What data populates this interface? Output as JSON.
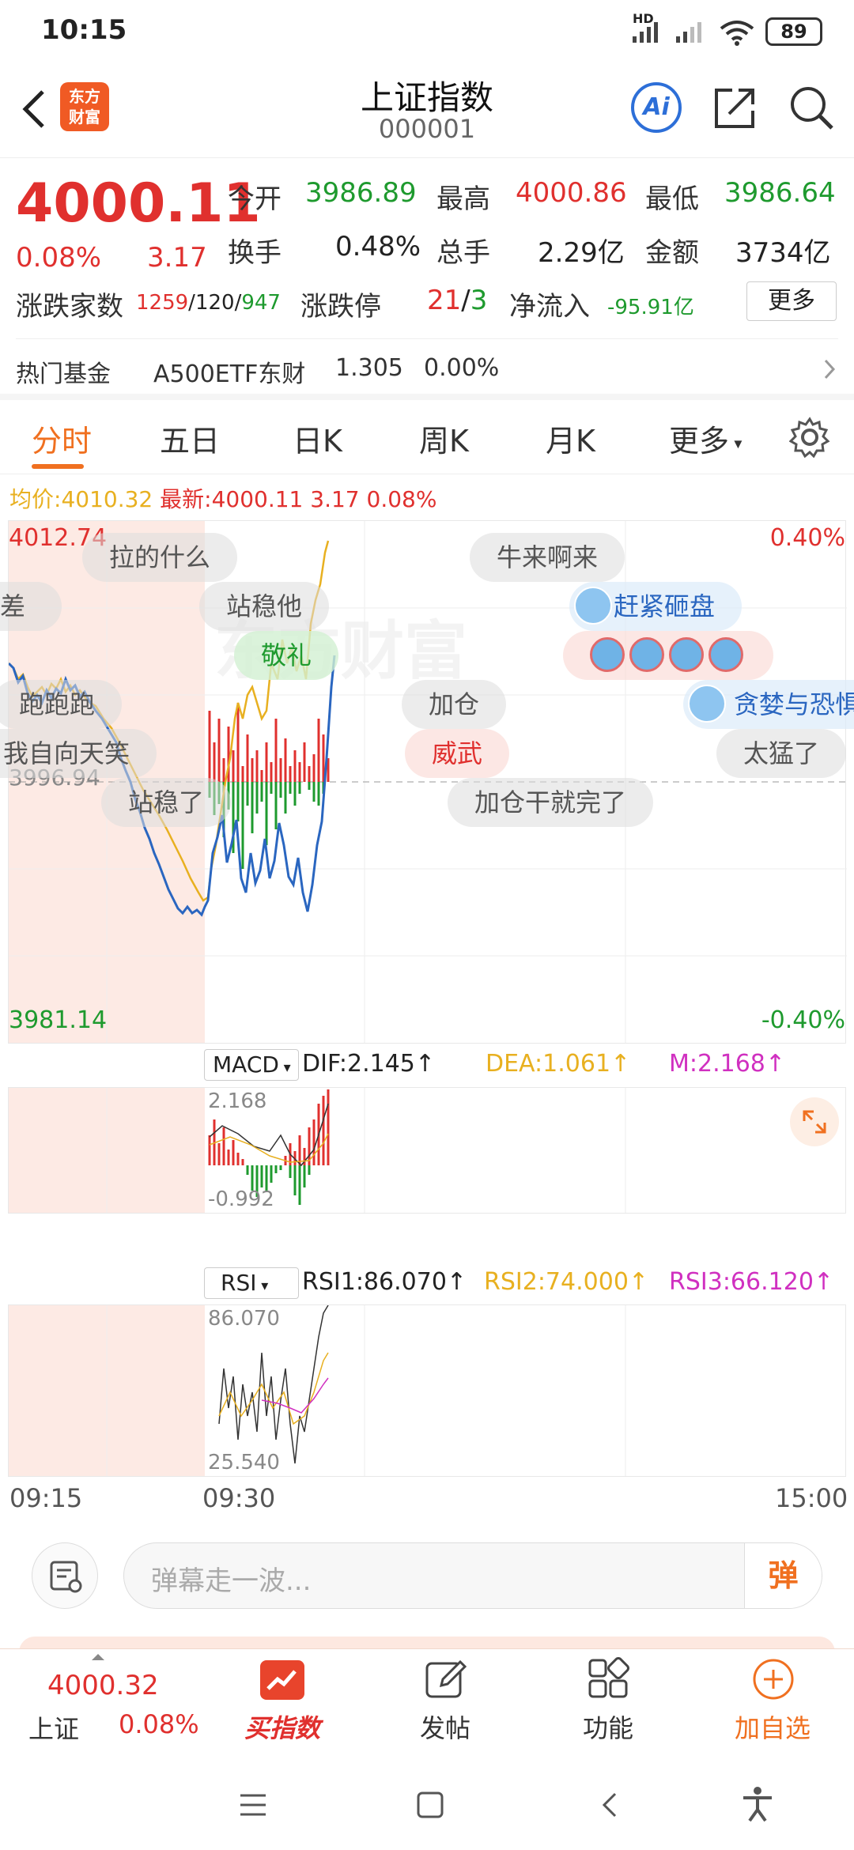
{
  "status": {
    "time": "10:15",
    "battery": "89",
    "hd": "HD"
  },
  "header": {
    "title": "上证指数",
    "code": "000001",
    "ai": "Ai"
  },
  "quote": {
    "price": "4000.11",
    "pct": "0.08%",
    "chg": "3.17",
    "open_label": "今开",
    "open": "3986.89",
    "high_label": "最高",
    "high": "4000.86",
    "low_label": "最低",
    "low": "3986.64",
    "turnover_label": "换手",
    "turnover": "0.48%",
    "volume_label": "总手",
    "volume": "2.29亿",
    "amount_label": "金额",
    "amount": "3734亿",
    "adv_label": "涨跌家数",
    "adv_up": "1259",
    "adv_sep1": "/",
    "adv_flat": "120",
    "adv_sep2": "/",
    "adv_down": "947",
    "limit_label": "涨跌停",
    "limit_up": "21",
    "limit_sep": "/",
    "limit_down": "3",
    "inflow_label": "净流入",
    "inflow": "-95.91亿",
    "more": "更多"
  },
  "fund": {
    "label": "热门基金",
    "name": "A500ETF东财",
    "price": "1.305",
    "pct": "0.00%"
  },
  "tabs": [
    "分时",
    "五日",
    "日K",
    "周K",
    "月K",
    "更多"
  ],
  "legend": {
    "avg_label": "均价:",
    "avg": "4010.32",
    "latest_label": "最新:",
    "latest": "4000.11",
    "chg": "3.17",
    "pct": "0.08%"
  },
  "price_chart": {
    "ymax": "4012.74",
    "ymin": "3981.14",
    "pmax": "0.40%",
    "pmin": "-0.40%",
    "base": "3996.94",
    "watermark": "东方财富"
  },
  "danmaku": [
    "拉的什么",
    "牛来啊来",
    "站稳他",
    "赶紧砸盘",
    "敬礼",
    "跑跑跑",
    "加仓",
    "贪婪与恐惧",
    "我自向天笑",
    "威武",
    "太猛了",
    "站稳了",
    "加仓干就完了",
    "差"
  ],
  "macd": {
    "label": "MACD",
    "dif": "DIF:2.145↑",
    "dea": "DEA:1.061↑",
    "m": "M:2.168↑",
    "max": "2.168",
    "min": "-0.992"
  },
  "rsi": {
    "label": "RSI",
    "rsi1": "RSI1:86.070↑",
    "rsi2": "RSI2:74.000↑",
    "rsi3": "RSI3:66.120↑",
    "max": "86.070",
    "min": "25.540"
  },
  "time_axis": [
    "09:15",
    "09:30",
    "15:00"
  ],
  "input": {
    "placeholder": "弹幕走一波...",
    "dan": "弹"
  },
  "bottom": {
    "index_price": "4000.32",
    "index_name": "上证",
    "index_pct": "0.08%",
    "buy": "买指数",
    "post": "发帖",
    "func": "功能",
    "add": "加自选"
  },
  "colors": {
    "up": "#e0302e",
    "down": "#1e9a2e",
    "accent": "#f07020",
    "line": "#2a66c0",
    "avg": "#e8b020"
  }
}
